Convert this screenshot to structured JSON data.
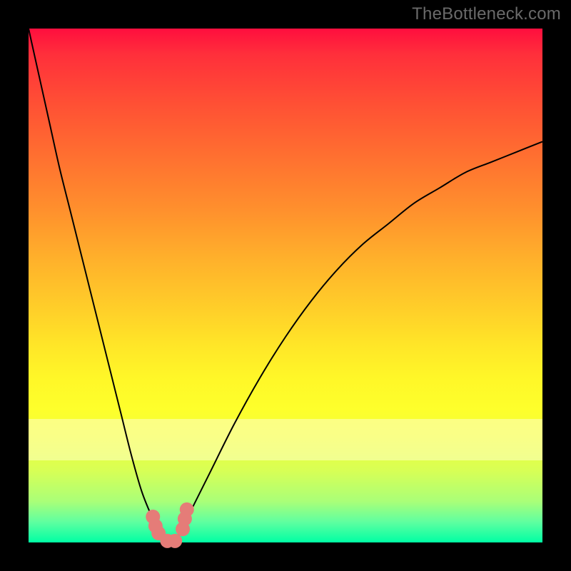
{
  "watermark": "TheBottleneck.com",
  "band": {
    "top_pct": 76,
    "height_pct": 8
  },
  "chart_data": {
    "type": "line",
    "title": "",
    "xlabel": "",
    "ylabel": "",
    "xlim": [
      0,
      100
    ],
    "ylim": [
      0,
      100
    ],
    "x": [
      0,
      2,
      4,
      6,
      8,
      10,
      12,
      14,
      16,
      18,
      20,
      22,
      24,
      26,
      27,
      28,
      29,
      30,
      35,
      40,
      45,
      50,
      55,
      60,
      65,
      70,
      75,
      80,
      85,
      90,
      95,
      100
    ],
    "values": [
      100,
      91,
      82,
      73,
      65,
      57,
      49,
      41,
      33,
      25,
      17,
      10,
      5,
      1,
      0,
      0,
      1,
      3,
      13,
      23,
      32,
      40,
      47,
      53,
      58,
      62,
      66,
      69,
      72,
      74,
      76,
      78
    ],
    "minimum_x": 27.5,
    "markers": [
      {
        "x": 24.2,
        "y": 5.0
      },
      {
        "x": 24.7,
        "y": 3.2
      },
      {
        "x": 25.3,
        "y": 1.8
      },
      {
        "x": 27.0,
        "y": 0.3
      },
      {
        "x": 28.5,
        "y": 0.3
      },
      {
        "x": 30.0,
        "y": 2.6
      },
      {
        "x": 30.4,
        "y": 4.6
      },
      {
        "x": 30.8,
        "y": 6.4
      }
    ],
    "marker_radius_px": 10,
    "gradient_note": "background encodes value: top=red (high), bottom=green (low)"
  }
}
